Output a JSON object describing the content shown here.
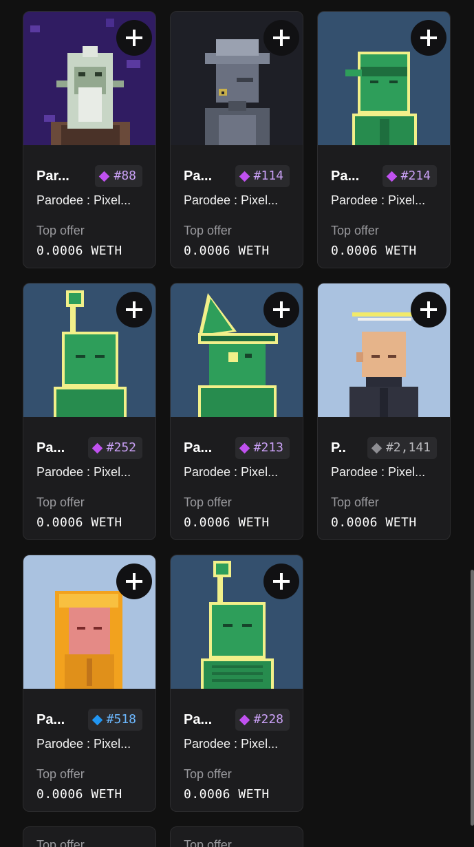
{
  "cards": [
    {
      "name": "Par...",
      "token": "#88",
      "gem_color": "#c051f0",
      "token_color": "#c9a0f5",
      "collection": "Parodee : Pixel...",
      "offer_label": "Top offer",
      "offer_value": "0.0006 WETH",
      "art": "elder-robed-avatar"
    },
    {
      "name": "Pa...",
      "token": "#114",
      "gem_color": "#c051f0",
      "token_color": "#c9a0f5",
      "collection": "Parodee : Pixel...",
      "offer_label": "Top offer",
      "offer_value": "0.0006 WETH",
      "art": "gray-hat-monocle-avatar"
    },
    {
      "name": "Pa...",
      "token": "#214",
      "gem_color": "#c051f0",
      "token_color": "#c9a0f5",
      "collection": "Parodee : Pixel...",
      "offer_label": "Top offer",
      "offer_value": "0.0006 WETH",
      "art": "green-ninja-avatar"
    },
    {
      "name": "Pa...",
      "token": "#252",
      "gem_color": "#c051f0",
      "token_color": "#c9a0f5",
      "collection": "Parodee : Pixel...",
      "offer_label": "Top offer",
      "offer_value": "0.0006 WETH",
      "art": "green-antenna-avatar"
    },
    {
      "name": "Pa...",
      "token": "#213",
      "gem_color": "#c051f0",
      "token_color": "#c9a0f5",
      "collection": "Parodee : Pixel...",
      "offer_label": "Top offer",
      "offer_value": "0.0006 WETH",
      "art": "green-wizard-avatar"
    },
    {
      "name": "P..",
      "token": "#2,141",
      "gem_color": "#8e8e93",
      "token_color": "#b8b8bc",
      "collection": "Parodee : Pixel...",
      "offer_label": "Top offer",
      "offer_value": "0.0006 WETH",
      "art": "bald-halo-avatar"
    },
    {
      "name": "Pa...",
      "token": "#518",
      "gem_color": "#2196f3",
      "token_color": "#6cb8ff",
      "collection": "Parodee : Pixel...",
      "offer_label": "Top offer",
      "offer_value": "0.0006 WETH",
      "art": "yellow-hood-avatar"
    },
    {
      "name": "Pa...",
      "token": "#228",
      "gem_color": "#c051f0",
      "token_color": "#c9a0f5",
      "collection": "Parodee : Pixel...",
      "offer_label": "Top offer",
      "offer_value": "0.0006 WETH",
      "art": "green-skeleton-avatar"
    }
  ],
  "partial_row": {
    "label": "Top offer"
  },
  "colors": {
    "background": "#111111",
    "card": "#1c1c1e",
    "badge": "#2a2a2d",
    "muted": "#9a9a9e"
  },
  "icons": {
    "add": "plus-icon",
    "rarity": "diamond-icon"
  }
}
